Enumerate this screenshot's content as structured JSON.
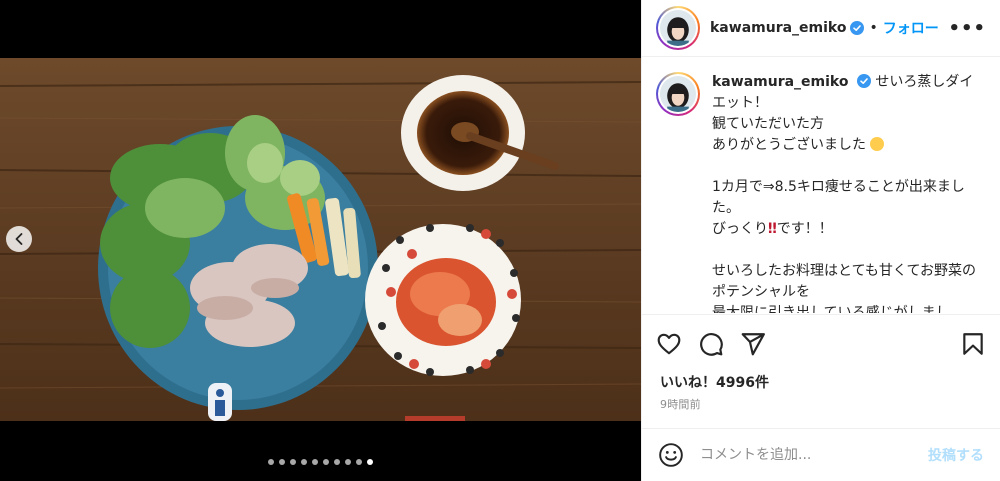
{
  "header": {
    "username": "kawamura_emiko",
    "separator": "•",
    "follow_label": "フォロー",
    "more_label": "•••"
  },
  "caption": {
    "username": "kawamura_emiko",
    "lines": [
      "せいろ蒸しダイエット！",
      "観ていただいた方",
      "ありがとうございました",
      "",
      "1カ月で⇒8.5キロ痩せることが出来ました。",
      "びっくり",
      "",
      "せいろしたお料理はとても甘くてお野菜のポテンシャルを",
      "最大限に引き出している感じがしまし"
    ],
    "line5_suffix": "です！！"
  },
  "likes": {
    "text": "いいね！4996件"
  },
  "timestamp": "9時間前",
  "comment_box": {
    "placeholder": "コメントを追加...",
    "post_label": "投稿する"
  },
  "carousel": {
    "total": 10,
    "active_index": 9
  },
  "colors": {
    "accent": "#0095f6",
    "post_disabled": "#b2dffc",
    "muted": "#8e8e8e"
  },
  "icons": [
    "chevron-left-icon",
    "verified-badge-icon",
    "heart-icon",
    "comment-icon",
    "share-icon",
    "bookmark-icon",
    "emoji-icon"
  ]
}
